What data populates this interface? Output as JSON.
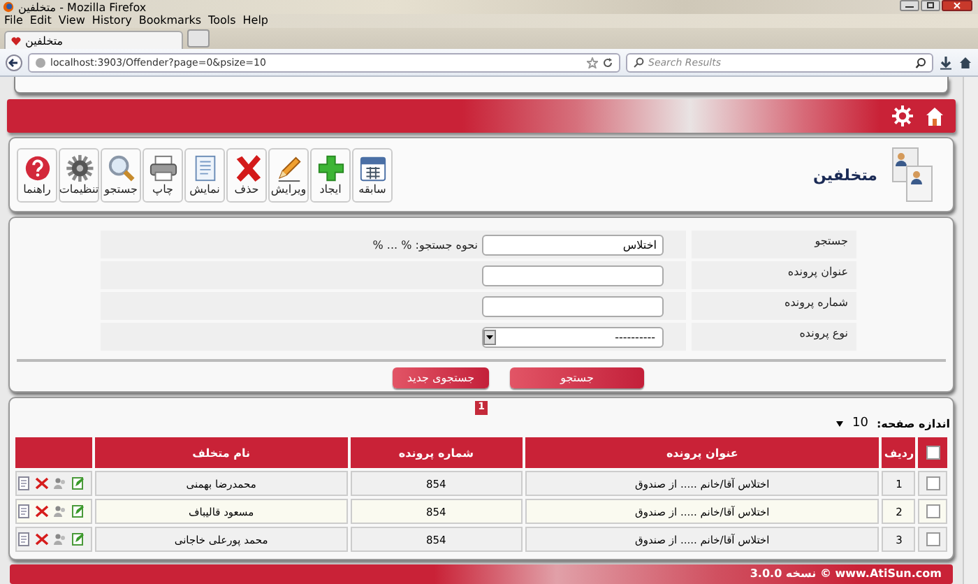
{
  "window": {
    "title": "متخلفین - Mozilla Firefox"
  },
  "menu": {
    "file": "File",
    "edit": "Edit",
    "view": "View",
    "history": "History",
    "bookmarks": "Bookmarks",
    "tools": "Tools",
    "help": "Help"
  },
  "tabs": [
    {
      "label": "متخلفین",
      "selected": true
    }
  ],
  "address": {
    "value": "localhost:3903/Offender?page=0&psize=10"
  },
  "search": {
    "placeholder": "Search Results"
  },
  "page": {
    "title": "متخلفین"
  },
  "toolbar": [
    "سابقه",
    "ایجاد",
    "ویرایش",
    "حذف",
    "نمایش",
    "چاپ",
    "جستجو",
    "تنظیمات",
    "راهنما"
  ],
  "form": {
    "rows": [
      {
        "kind": "text",
        "label": "جستجو",
        "value": "اختلاس",
        "hint": "نحوه جستجو: % ... %"
      },
      {
        "kind": "text",
        "label": "عنوان پرونده"
      },
      {
        "kind": "text",
        "label": "شماره پرونده"
      },
      {
        "kind": "select",
        "label": "نوع پرونده",
        "value": "----------"
      }
    ],
    "buttons": [
      "جستجو",
      "جستجوی جدید"
    ]
  },
  "pager": {
    "pages": [
      {
        "label": "1",
        "selected": true
      }
    ],
    "page_size_label": "اندازه صفحه:",
    "page_size": "10"
  },
  "table": {
    "columns": [
      "ردیف",
      "عنوان پرونده",
      "شماره پرونده",
      "نام متخلف"
    ],
    "header_checked": false,
    "rows": [
      {
        "checked": false,
        "cells": [
          "1",
          "اختلاس آقا/خانم ..... از صندوق",
          "854",
          "محمدرضا بهمنی"
        ]
      },
      {
        "checked": false,
        "cells": [
          "2",
          "اختلاس آقا/خانم ..... از صندوق",
          "854",
          "مسعود قالیباف"
        ]
      },
      {
        "checked": false,
        "cells": [
          "3",
          "اختلاس آقا/خانم ..... از صندوق",
          "854",
          "محمد پورعلی خاجانی"
        ]
      }
    ]
  },
  "footer": {
    "text": "www.AtiSun.com © نسخه 3.0.0"
  }
}
